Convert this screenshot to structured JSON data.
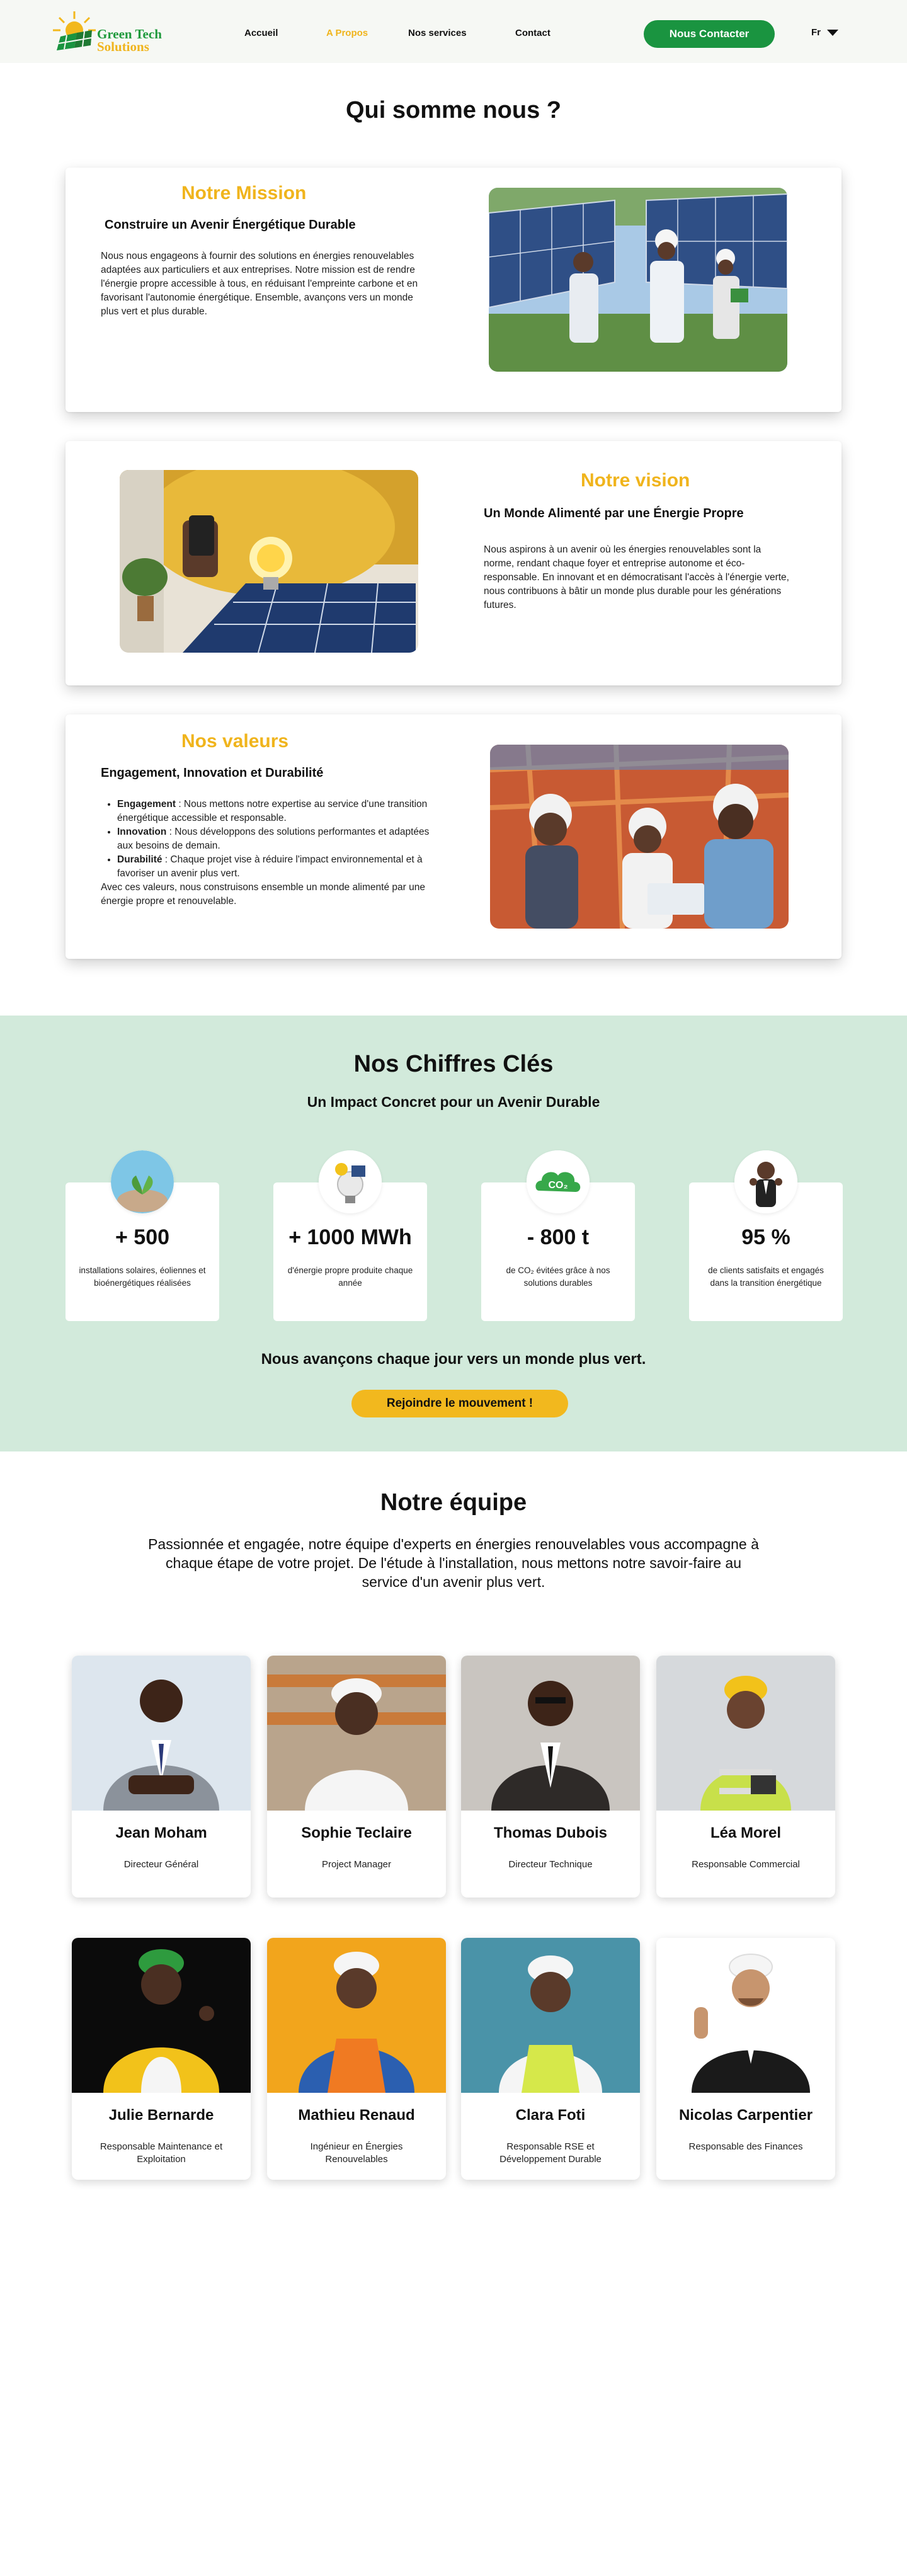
{
  "header": {
    "logo_line1": "Green Tech",
    "logo_line2": "Solutions",
    "nav": [
      "Accueil",
      "A Propos",
      "Nos services",
      "Contact"
    ],
    "active_nav": "A Propos",
    "contact_button": "Nous Contacter",
    "language": "Fr"
  },
  "about": {
    "title": "Qui somme nous ?",
    "mission": {
      "heading": "Notre Mission",
      "subheading": "Construire un Avenir Énergétique Durable",
      "text": "Nous nous engageons à fournir des solutions en énergies renouvelables adaptées aux particuliers et aux entreprises. Notre mission est de rendre l'énergie propre accessible à tous, en réduisant l'empreinte carbone et en favorisant l'autonomie énergétique. Ensemble, avançons vers un monde plus vert et plus durable."
    },
    "vision": {
      "heading": "Notre vision",
      "subheading": "Un Monde Alimenté par une Énergie Propre",
      "text": "Nous aspirons à un avenir où les énergies renouvelables sont la norme, rendant chaque foyer et entreprise autonome et éco-responsable. En innovant et en démocratisant l'accès à l'énergie verte, nous contribuons à bâtir un monde plus durable pour les générations futures."
    },
    "values": {
      "heading": "Nos valeurs",
      "subheading": "Engagement, Innovation et Durabilité",
      "items": [
        {
          "term": "Engagement",
          "text": " : Nous mettons notre expertise au service d'une transition énergétique accessible et responsable."
        },
        {
          "term": "Innovation",
          "text": " : Nous développons des solutions performantes et adaptées aux besoins de demain."
        },
        {
          "term": "Durabilité",
          "text": " : Chaque projet vise à réduire l'impact environnemental et à favoriser un avenir plus vert."
        }
      ],
      "closing": "Avec ces valeurs, nous construisons ensemble un monde alimenté par une énergie propre et renouvelable."
    }
  },
  "stats": {
    "title": "Nos Chiffres Clés",
    "subtitle": "Un Impact Concret pour un Avenir Durable",
    "items": [
      {
        "value": "+ 500",
        "desc": "installations solaires, éoliennes et bioénergétiques réalisées",
        "icon": "globe-plant-icon"
      },
      {
        "value": "+ 1000 MWh",
        "desc": "d'énergie propre produite chaque année",
        "icon": "solar-bulb-icon"
      },
      {
        "value": "- 800 t",
        "desc": "de CO₂ évitées grâce à nos solutions durables",
        "icon": "co2-cloud-icon"
      },
      {
        "value": "95 %",
        "desc": "de clients satisfaits et engagés dans la transition énergétique",
        "icon": "thumbs-up-person-icon"
      }
    ],
    "tagline": "Nous avançons chaque jour vers un monde plus vert.",
    "join_button": "Rejoindre le mouvement !"
  },
  "team": {
    "title": "Notre équipe",
    "intro": "Passionnée et engagée, notre équipe d'experts en énergies renouvelables vous accompagne à chaque étape de votre projet. De l'étude à l'installation, nous mettons notre savoir-faire au service d'un avenir plus vert.",
    "members": [
      {
        "name": "Jean Moham",
        "role": "Directeur Général"
      },
      {
        "name": "Sophie Teclaire",
        "role": "Project Manager"
      },
      {
        "name": "Thomas Dubois",
        "role": "Directeur Technique"
      },
      {
        "name": "Léa Morel",
        "role": "Responsable Commercial"
      },
      {
        "name": "Julie Bernarde",
        "role": "Responsable Maintenance et Exploitation"
      },
      {
        "name": "Mathieu Renaud",
        "role": "Ingénieur en Énergies Renouvelables"
      },
      {
        "name": "Clara Foti",
        "role": "Responsable RSE et Développement Durable"
      },
      {
        "name": "Nicolas Carpentier",
        "role": "Responsable des Finances"
      }
    ]
  },
  "colors": {
    "accent_yellow": "#f0b41c",
    "brand_green": "#1a9440",
    "stats_bg": "#d2eadb"
  }
}
